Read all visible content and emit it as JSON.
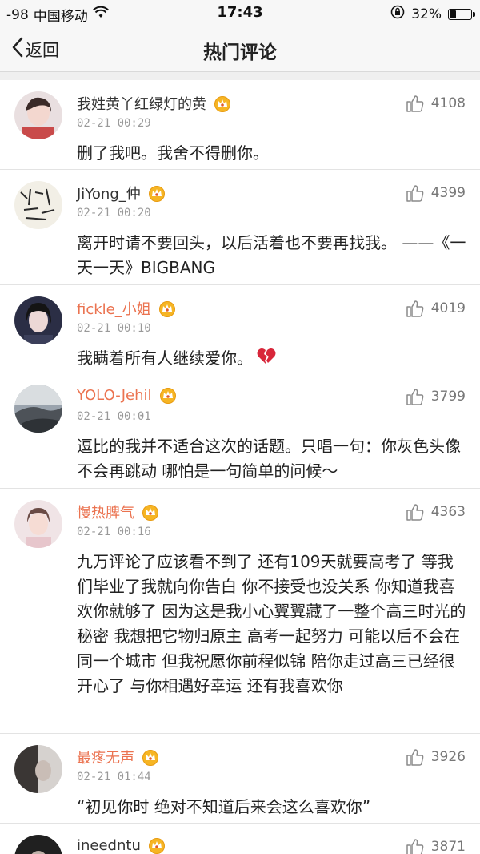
{
  "status_bar": {
    "signal": "-98",
    "carrier": "中国移动",
    "time": "17:43",
    "battery": "32%",
    "battery_level": 0.32
  },
  "nav": {
    "back_label": "返回",
    "title": "热门评论"
  },
  "comments": [
    {
      "username": "我姓黄丫红绿灯的黄",
      "time": "02-21 00:29",
      "likes": "4108",
      "text": "删了我吧。我舍不得删你。",
      "name_color": "#333333"
    },
    {
      "username": "JiYong_仲",
      "time": "02-21 00:20",
      "likes": "4399",
      "text": "离开时请不要回头，以后活着也不要再找我。 ——《一天一天》BIGBANG",
      "name_color": "#333333"
    },
    {
      "username": "fickle_小姐",
      "time": "02-21 00:10",
      "likes": "4019",
      "text": "我瞒着所有人继续爱你。",
      "name_color": "#eb7350",
      "emoji": "broken-heart-icon"
    },
    {
      "username": "YOLO-Jehil",
      "time": "02-21 00:01",
      "likes": "3799",
      "text": "逗比的我并不适合这次的话题。只唱一句：你灰色头像不会再跳动 哪怕是一句简单的问候～",
      "name_color": "#eb7350"
    },
    {
      "username": "慢热脾气",
      "time": "02-21 00:16",
      "likes": "4363",
      "text": "九万评论了应该看不到了 还有109天就要高考了 等我们毕业了我就向你告白 你不接受也没关系 你知道我喜欢你就够了 因为这是我小心翼翼藏了一整个高三时光的秘密 我想把它物归原主 高考一起努力 可能以后不会在同一个城市 但我祝愿你前程似锦 陪你走过高三已经很开心了 与你相遇好幸运 还有我喜欢你",
      "name_color": "#eb7350"
    },
    {
      "username": "最疼无声",
      "time": "02-21 01:44",
      "likes": "3926",
      "text": "“初见你时 绝对不知道后来会这么喜欢你”",
      "name_color": "#eb7350"
    },
    {
      "username": "ineedntu",
      "time": "",
      "likes": "3871",
      "text": "",
      "name_color": "#333333"
    }
  ]
}
